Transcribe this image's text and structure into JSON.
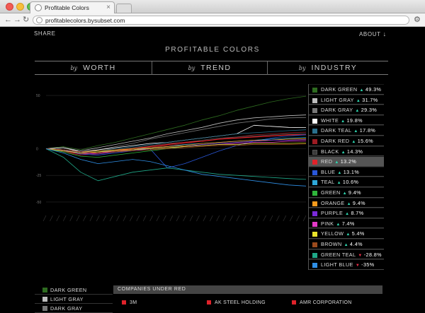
{
  "browser": {
    "tab_title": "Profitable Colors",
    "tab_close": "×",
    "url": "profitablecolors.bysubset.com",
    "back_icon": "←",
    "forward_icon": "→",
    "reload_icon": "↻",
    "wrench_icon": "🔧"
  },
  "header": {
    "share": "SHARE",
    "about": "ABOUT",
    "about_arrow": "↓",
    "title": "PROFITABLE COLORS"
  },
  "nav": [
    {
      "by": "by",
      "label": "WORTH"
    },
    {
      "by": "by",
      "label": "TREND"
    },
    {
      "by": "by",
      "label": "INDUSTRY"
    }
  ],
  "chart_data": {
    "type": "line",
    "ylim": [
      -60,
      60
    ],
    "yticks": [
      50,
      0,
      -25,
      -50
    ],
    "title": "",
    "xlabel": "",
    "ylabel": "",
    "grid": true,
    "series": [
      {
        "name": "DARK GREEN",
        "color": "#2e6b20",
        "values": [
          0,
          2,
          -1,
          3,
          6,
          10,
          14,
          18,
          22,
          27,
          31,
          36,
          40,
          44,
          47,
          49.3
        ]
      },
      {
        "name": "LIGHT GRAY",
        "color": "#bdbdbd",
        "values": [
          0,
          1,
          -2,
          1,
          4,
          7,
          10,
          14,
          17,
          20,
          24,
          27,
          29,
          30,
          31,
          31.7
        ]
      },
      {
        "name": "DARK GRAY",
        "color": "#777777",
        "values": [
          0,
          -2,
          -4,
          -1,
          2,
          5,
          9,
          12,
          15,
          18,
          21,
          24,
          26,
          28,
          29,
          29.3
        ]
      },
      {
        "name": "WHITE",
        "color": "#ffffff",
        "values": [
          0,
          1,
          -3,
          -1,
          1,
          3,
          5,
          6,
          8,
          10,
          12,
          14,
          22,
          21,
          20,
          19.8
        ]
      },
      {
        "name": "DARK TEAL",
        "color": "#2a6f8c",
        "values": [
          0,
          -1,
          -3,
          -2,
          0,
          2,
          4,
          6,
          8,
          10,
          12,
          14,
          15,
          16,
          17,
          17.8
        ]
      },
      {
        "name": "DARK RED",
        "color": "#9b1b22",
        "values": [
          0,
          -3,
          -6,
          -5,
          -3,
          -1,
          1,
          3,
          5,
          7,
          9,
          11,
          13,
          14,
          15,
          15.6
        ]
      },
      {
        "name": "BLACK",
        "color": "#3a3a3a",
        "values": [
          0,
          -1,
          -4,
          -3,
          -1,
          1,
          3,
          5,
          6,
          8,
          10,
          11,
          12,
          13,
          14,
          14.3
        ]
      },
      {
        "name": "RED",
        "color": "#e0222a",
        "values": [
          0,
          -2,
          -5,
          -4,
          -2,
          0,
          2,
          4,
          6,
          7,
          9,
          10,
          11,
          12,
          13,
          13.2
        ]
      },
      {
        "name": "BLUE",
        "color": "#2a57d8",
        "values": [
          0,
          -1,
          -5,
          -6,
          -4,
          -2,
          0,
          -18,
          -14,
          -8,
          -2,
          3,
          7,
          10,
          12,
          13.1
        ]
      },
      {
        "name": "TEAL",
        "color": "#2fa8d8",
        "values": [
          0,
          -2,
          -4,
          -3,
          -2,
          -1,
          1,
          2,
          4,
          5,
          6,
          7,
          8,
          9,
          10,
          10.6
        ]
      },
      {
        "name": "GREEN",
        "color": "#2fb53b",
        "values": [
          0,
          -3,
          -7,
          -8,
          -6,
          -4,
          -2,
          0,
          2,
          4,
          5,
          6,
          7,
          8,
          9,
          9.4
        ]
      },
      {
        "name": "ORANGE",
        "color": "#f39a1d",
        "values": [
          0,
          -1,
          -3,
          -2,
          -1,
          0,
          1,
          2,
          3,
          5,
          6,
          7,
          8,
          8,
          9,
          9.4
        ]
      },
      {
        "name": "PURPLE",
        "color": "#7a2ad8",
        "values": [
          0,
          -2,
          -4,
          -5,
          -3,
          -2,
          0,
          1,
          2,
          4,
          5,
          6,
          7,
          8,
          8,
          8.7
        ]
      },
      {
        "name": "PINK",
        "color": "#e43ac8",
        "values": [
          0,
          -1,
          -3,
          -4,
          -2,
          -1,
          0,
          1,
          2,
          3,
          4,
          5,
          6,
          6,
          7,
          7.4
        ]
      },
      {
        "name": "YELLOW",
        "color": "#e8e22a",
        "values": [
          0,
          -2,
          -4,
          -3,
          -2,
          -1,
          0,
          1,
          2,
          3,
          4,
          4,
          5,
          5,
          5,
          5.4
        ]
      },
      {
        "name": "BROWN",
        "color": "#9a4a1d",
        "values": [
          0,
          -1,
          -3,
          -4,
          -3,
          -2,
          -1,
          0,
          1,
          2,
          3,
          3,
          4,
          4,
          4,
          4.4
        ]
      },
      {
        "name": "GREEN TEAL",
        "color": "#1fa888",
        "values": [
          0,
          -8,
          -22,
          -30,
          -26,
          -22,
          -20,
          -18,
          -20,
          -22,
          -24,
          -25,
          -26,
          -27,
          -28,
          -28.8
        ]
      },
      {
        "name": "LIGHT BLUE",
        "color": "#2f8fe6",
        "values": [
          0,
          -4,
          -10,
          -14,
          -12,
          -10,
          -12,
          -16,
          -20,
          -24,
          -26,
          -28,
          -30,
          -32,
          -34,
          -35
        ]
      }
    ]
  },
  "legend": [
    {
      "name": "DARK GREEN",
      "color": "#2e6b20",
      "dir": "up",
      "value": "49.3%"
    },
    {
      "name": "LIGHT GRAY",
      "color": "#bdbdbd",
      "dir": "up",
      "value": "31.7%"
    },
    {
      "name": "DARK GRAY",
      "color": "#777777",
      "dir": "up",
      "value": "29.3%"
    },
    {
      "name": "WHITE",
      "color": "#ffffff",
      "dir": "up",
      "value": "19.8%"
    },
    {
      "name": "DARK TEAL",
      "color": "#2a6f8c",
      "dir": "up",
      "value": "17.8%"
    },
    {
      "name": "DARK RED",
      "color": "#9b1b22",
      "dir": "up",
      "value": "15.6%"
    },
    {
      "name": "BLACK",
      "color": "#3a3a3a",
      "dir": "up",
      "value": "14.3%"
    },
    {
      "name": "RED",
      "color": "#e0222a",
      "dir": "up",
      "value": "13.2%",
      "selected": true
    },
    {
      "name": "BLUE",
      "color": "#2a57d8",
      "dir": "up",
      "value": "13.1%"
    },
    {
      "name": "TEAL",
      "color": "#2fa8d8",
      "dir": "up",
      "value": "10.6%"
    },
    {
      "name": "GREEN",
      "color": "#2fb53b",
      "dir": "up",
      "value": "9.4%"
    },
    {
      "name": "ORANGE",
      "color": "#f39a1d",
      "dir": "up",
      "value": "9.4%"
    },
    {
      "name": "PURPLE",
      "color": "#7a2ad8",
      "dir": "up",
      "value": "8.7%"
    },
    {
      "name": "PINK",
      "color": "#e43ac8",
      "dir": "up",
      "value": "7.4%"
    },
    {
      "name": "YELLOW",
      "color": "#e8e22a",
      "dir": "up",
      "value": "5.4%"
    },
    {
      "name": "BROWN",
      "color": "#9a4a1d",
      "dir": "up",
      "value": "4.4%"
    },
    {
      "name": "GREEN TEAL",
      "color": "#1fa888",
      "dir": "down",
      "value": "-28.8%"
    },
    {
      "name": "LIGHT BLUE",
      "color": "#2f8fe6",
      "dir": "down",
      "value": "-35%"
    }
  ],
  "bottom_legend": [
    {
      "name": "DARK GREEN",
      "color": "#2e6b20"
    },
    {
      "name": "LIGHT GRAY",
      "color": "#bdbdbd"
    },
    {
      "name": "DARK GRAY",
      "color": "#777777"
    }
  ],
  "companies": {
    "header": "COMPANIES UNDER RED",
    "items": [
      "3M",
      "AK STEEL HOLDING",
      "AMR CORPORATION"
    ]
  }
}
